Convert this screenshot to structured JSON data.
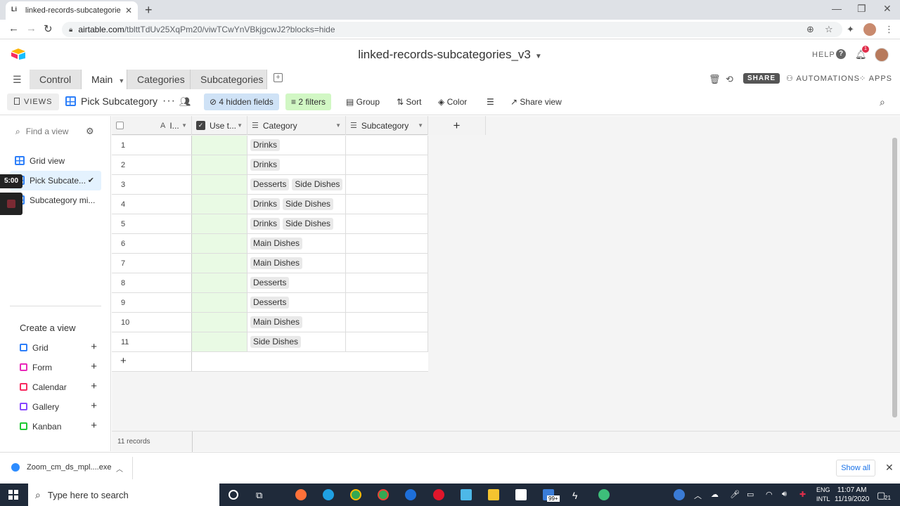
{
  "browser": {
    "tab_title": "linked-records-subcategories_v3",
    "tab_favicon": "Li",
    "url_main": "airtable.com",
    "url_rest": "/tblttTdUv25XqPm20/viwTCwYnVBkjgcwJ2?blocks=hide"
  },
  "header": {
    "base_title": "linked-records-subcategories_v3",
    "help": "HELP",
    "notification_count": "1"
  },
  "tables": [
    {
      "label": "Control"
    },
    {
      "label": "Main"
    },
    {
      "label": "Categories"
    },
    {
      "label": "Subcategories"
    }
  ],
  "toolbar": {
    "share": "SHARE",
    "automations": "AUTOMATIONS",
    "apps": "APPS"
  },
  "viewbar": {
    "views": "VIEWS",
    "view_name": "Pick Subcategory",
    "hidden_fields": "4 hidden fields",
    "filters": "2 filters",
    "group": "Group",
    "sort": "Sort",
    "color": "Color",
    "share_view": "Share view"
  },
  "sidebar": {
    "find_placeholder": "Find a view",
    "views": [
      {
        "label": "Grid view"
      },
      {
        "label": "Pick Subcate..."
      },
      {
        "label": "Subcategory mi..."
      }
    ],
    "timer": "5:00",
    "create_heading": "Create a view",
    "create_items": [
      {
        "label": "Grid",
        "color": "#2d7ff9"
      },
      {
        "label": "Form",
        "color": "#e929ba"
      },
      {
        "label": "Calendar",
        "color": "#f82b60"
      },
      {
        "label": "Gallery",
        "color": "#8b46ff"
      },
      {
        "label": "Kanban",
        "color": "#20c933"
      }
    ]
  },
  "grid": {
    "columns": [
      {
        "label": "I...",
        "icon": "A"
      },
      {
        "label": "Use t...",
        "icon": "checkbox-icon"
      },
      {
        "label": "Category",
        "icon": "linked-record-icon"
      },
      {
        "label": "Subcategory",
        "icon": "linked-record-icon"
      }
    ],
    "rows": [
      {
        "num": "1",
        "category": [
          "Drinks"
        ]
      },
      {
        "num": "2",
        "category": [
          "Drinks"
        ]
      },
      {
        "num": "3",
        "category": [
          "Desserts",
          "Side Dishes"
        ]
      },
      {
        "num": "4",
        "category": [
          "Drinks",
          "Side Dishes"
        ]
      },
      {
        "num": "5",
        "category": [
          "Drinks",
          "Side Dishes"
        ]
      },
      {
        "num": "6",
        "category": [
          "Main Dishes"
        ]
      },
      {
        "num": "7",
        "category": [
          "Main Dishes"
        ]
      },
      {
        "num": "8",
        "category": [
          "Desserts"
        ]
      },
      {
        "num": "9",
        "category": [
          "Desserts"
        ]
      },
      {
        "num": "10",
        "category": [
          "Main Dishes"
        ]
      },
      {
        "num": "11",
        "category": [
          "Side Dishes"
        ]
      }
    ],
    "record_count": "11 records"
  },
  "downloads": {
    "file": "Zoom_cm_ds_mpl....exe",
    "show_all": "Show all"
  },
  "taskbar": {
    "search_placeholder": "Type here to search",
    "lang1": "ENG",
    "lang2": "INTL",
    "time": "11:07 AM",
    "date": "11/19/2020",
    "store_badge": "99+",
    "notif": "21"
  }
}
